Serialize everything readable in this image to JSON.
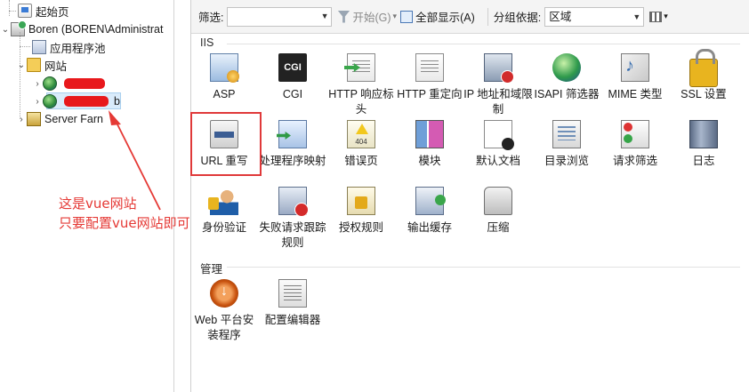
{
  "tree": {
    "start_page": "起始页",
    "server_node": "Boren (BOREN\\Administrat",
    "app_pools": "应用程序池",
    "sites": "网站",
    "site_2_suffix": "b",
    "server_farms": "Server Farn"
  },
  "toolbar": {
    "filter_label": "筛选:",
    "filter_value": "",
    "go_label": "开始(G)",
    "show_all_label": "全部显示(A)",
    "group_by_label": "分组依据:",
    "group_by_value": "区域"
  },
  "sections": {
    "iis_title": "IIS",
    "management_title": "管理"
  },
  "iis_features": [
    {
      "label": "ASP",
      "icon": "asp-icon"
    },
    {
      "label": "CGI",
      "icon": "cgi-icon"
    },
    {
      "label": "HTTP 响应标头",
      "icon": "http-response-headers-icon"
    },
    {
      "label": "HTTP 重定向",
      "icon": "http-redirect-icon"
    },
    {
      "label": "IP 地址和域限制",
      "icon": "ip-domain-restrictions-icon"
    },
    {
      "label": "ISAPI 筛选器",
      "icon": "isapi-filters-icon"
    },
    {
      "label": "MIME 类型",
      "icon": "mime-types-icon"
    },
    {
      "label": "SSL 设置",
      "icon": "ssl-lock-icon"
    },
    {
      "label": "URL 重写",
      "icon": "url-rewrite-icon"
    },
    {
      "label": "处理程序映射",
      "icon": "handler-mappings-icon"
    },
    {
      "label": "错误页",
      "icon": "error-pages-icon"
    },
    {
      "label": "模块",
      "icon": "modules-icon"
    },
    {
      "label": "默认文档",
      "icon": "default-document-icon"
    },
    {
      "label": "目录浏览",
      "icon": "directory-browsing-icon"
    },
    {
      "label": "请求筛选",
      "icon": "request-filtering-icon"
    },
    {
      "label": "日志",
      "icon": "logging-icon"
    },
    {
      "label": "身份验证",
      "icon": "authentication-icon"
    },
    {
      "label": "失败请求跟踪规则",
      "icon": "failed-request-tracing-icon"
    },
    {
      "label": "授权规则",
      "icon": "authorization-rules-icon"
    },
    {
      "label": "输出缓存",
      "icon": "output-caching-icon"
    },
    {
      "label": "压缩",
      "icon": "compression-icon"
    }
  ],
  "management_features": [
    {
      "label": "Web 平台安装程序",
      "icon": "web-platform-installer-icon"
    },
    {
      "label": "配置编辑器",
      "icon": "configuration-editor-icon"
    }
  ],
  "annotation": {
    "line1": "这是vue网站",
    "line2": "只要配置vue网站即可",
    "color": "#e53935"
  }
}
